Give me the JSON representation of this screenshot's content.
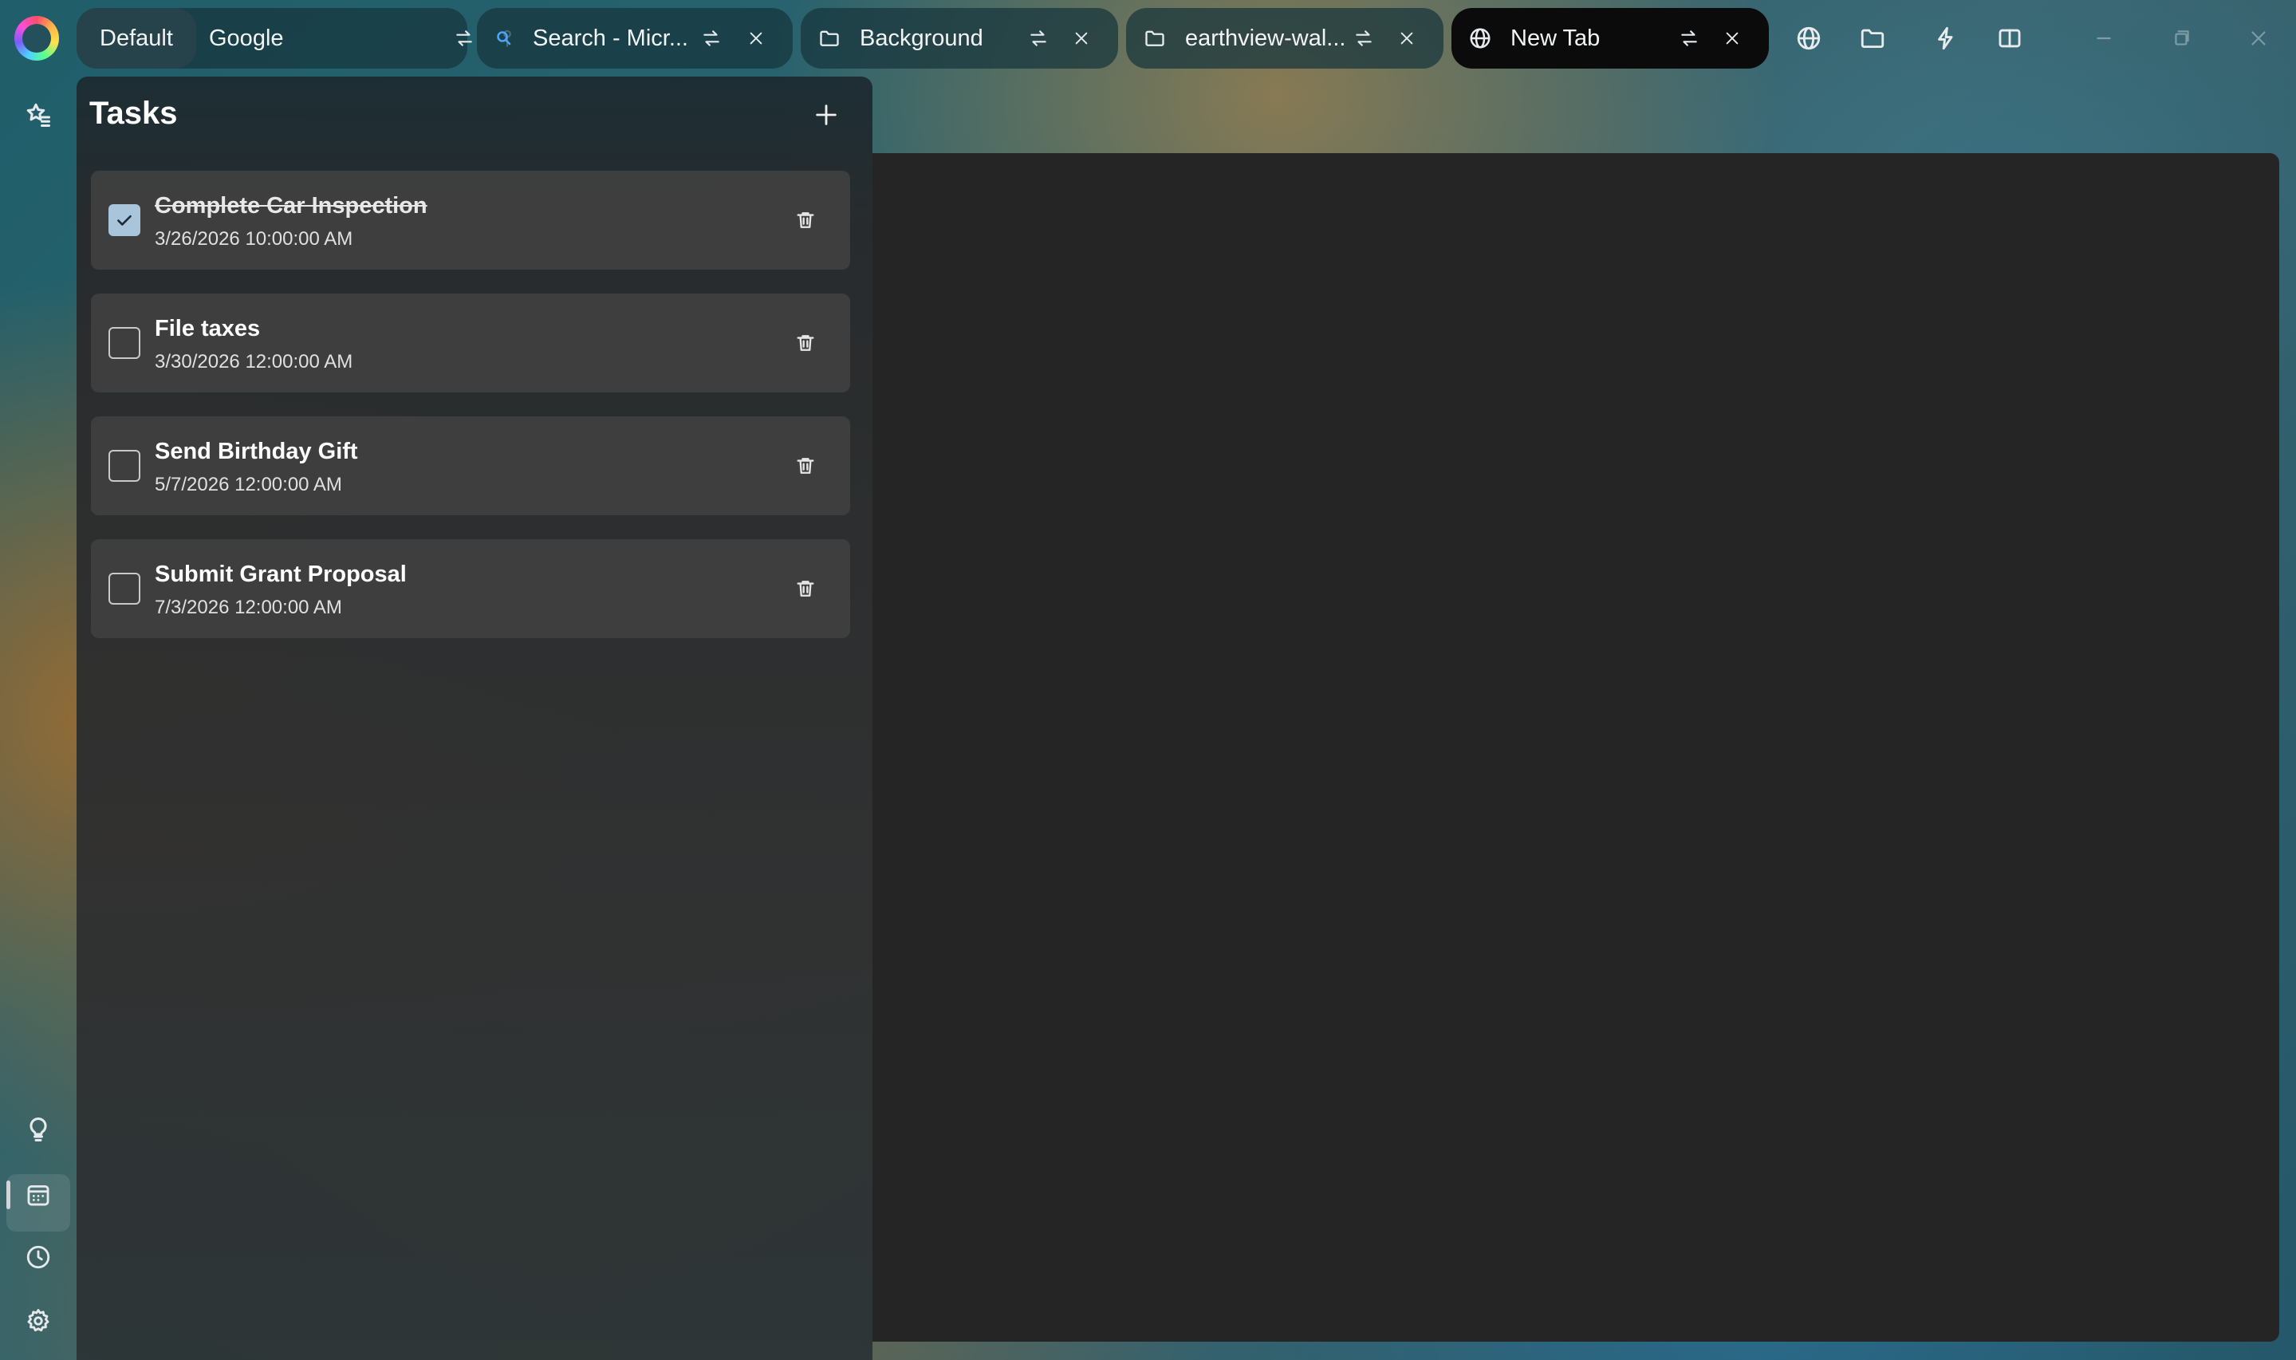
{
  "topbar": {
    "workspace": "Default",
    "tabs": [
      {
        "label": "Google",
        "icon": "none",
        "action": "pin-icon"
      },
      {
        "label": "Search - Micr...",
        "icon": "search-icon",
        "action": "close-icon"
      },
      {
        "label": "Background",
        "icon": "folder-icon",
        "action": "close-icon"
      },
      {
        "label": "earthview-wal...",
        "icon": "folder-icon",
        "action": "close-icon"
      },
      {
        "label": "New Tab",
        "icon": "globe-icon",
        "action": "close-icon",
        "active": true
      }
    ],
    "toolbar_icons": [
      "globe-icon",
      "folder-icon",
      "lightning-icon",
      "split-view-icon"
    ],
    "window_controls": [
      "minimize-icon",
      "restore-icon",
      "close-icon"
    ]
  },
  "sidebar": {
    "top_icons": [
      "favorites-icon"
    ],
    "bottom_icons": [
      "lightbulb-icon",
      "calendar-icon",
      "clock-icon",
      "settings-icon"
    ],
    "active": "calendar-icon"
  },
  "tasks_panel": {
    "title": "Tasks",
    "items": [
      {
        "name": "Complete Car Inspection",
        "date": "3/26/2026 10:00:00 AM",
        "done": true
      },
      {
        "name": "File taxes",
        "date": "3/30/2026 12:00:00 AM",
        "done": false
      },
      {
        "name": "Send Birthday Gift",
        "date": "5/7/2026 12:00:00 AM",
        "done": false
      },
      {
        "name": "Submit Grant Proposal",
        "date": "7/3/2026 12:00:00 AM",
        "done": false
      }
    ]
  },
  "colors": {
    "checkbox_checked": "#a9c5dc",
    "active_tab": "#0b0b0b",
    "panel_bg": "#303030",
    "content_bg": "#252525"
  }
}
